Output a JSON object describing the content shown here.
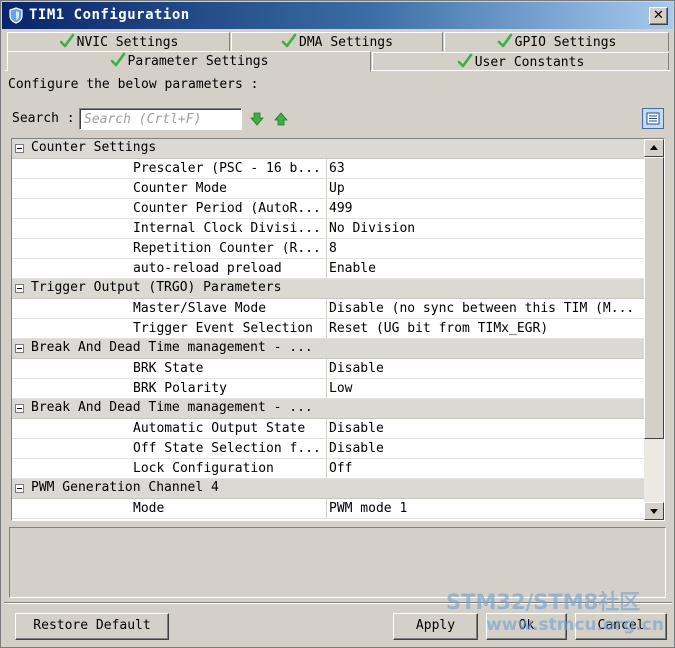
{
  "window": {
    "title": "TIM1 Configuration",
    "close_glyph": "✕"
  },
  "tabs": [
    {
      "label": "NVIC Settings",
      "status_icon": "check-icon"
    },
    {
      "label": "DMA Settings",
      "status_icon": "check-icon"
    },
    {
      "label": "GPIO Settings",
      "status_icon": "check-icon"
    },
    {
      "label": "Parameter Settings",
      "status_icon": "check-icon",
      "active": true
    },
    {
      "label": "User Constants",
      "status_icon": "check-icon"
    }
  ],
  "subtitle": "Configure the below parameters :",
  "search": {
    "label": "Search :",
    "placeholder": "Search (Crtl+F)",
    "value": ""
  },
  "table": {
    "sections": [
      {
        "label": "Counter Settings",
        "rows": [
          {
            "name": "Prescaler (PSC - 16 b...",
            "value": "63"
          },
          {
            "name": "Counter Mode",
            "value": "Up"
          },
          {
            "name": "Counter Period (AutoR...",
            "value": "499"
          },
          {
            "name": "Internal Clock Divisi...",
            "value": "No Division"
          },
          {
            "name": "Repetition Counter (R...",
            "value": "8"
          },
          {
            "name": "auto-reload preload",
            "value": "Enable"
          }
        ]
      },
      {
        "label": "Trigger Output (TRGO) Parameters",
        "rows": [
          {
            "name": "Master/Slave Mode",
            "value": "Disable (no sync between this TIM (M..."
          },
          {
            "name": "Trigger Event Selection",
            "value": "Reset (UG bit from TIMx_EGR)"
          }
        ]
      },
      {
        "label": "Break And Dead Time management - ...",
        "rows": [
          {
            "name": "BRK State",
            "value": "Disable"
          },
          {
            "name": "BRK Polarity",
            "value": "Low"
          }
        ]
      },
      {
        "label": "Break And Dead Time management - ...",
        "rows": [
          {
            "name": "Automatic Output State",
            "value": "Disable"
          },
          {
            "name": "Off State Selection f...",
            "value": "Disable"
          },
          {
            "name": "Lock Configuration",
            "value": "Off"
          }
        ]
      },
      {
        "label": "PWM Generation Channel 4",
        "rows": [
          {
            "name": "Mode",
            "value": "PWM mode 1"
          }
        ]
      }
    ]
  },
  "buttons": {
    "restore_default": "Restore Default",
    "apply": "Apply",
    "ok": "Ok",
    "cancel": "Cancel"
  },
  "watermark": {
    "line1": "STM32/STM8社区",
    "line2": "www.stmcu.org.cn"
  },
  "colors": {
    "check_green": "#3cb043",
    "arrow_green": "#2e9e2e",
    "title_start": "#0a246a",
    "title_end": "#a6caf0"
  }
}
